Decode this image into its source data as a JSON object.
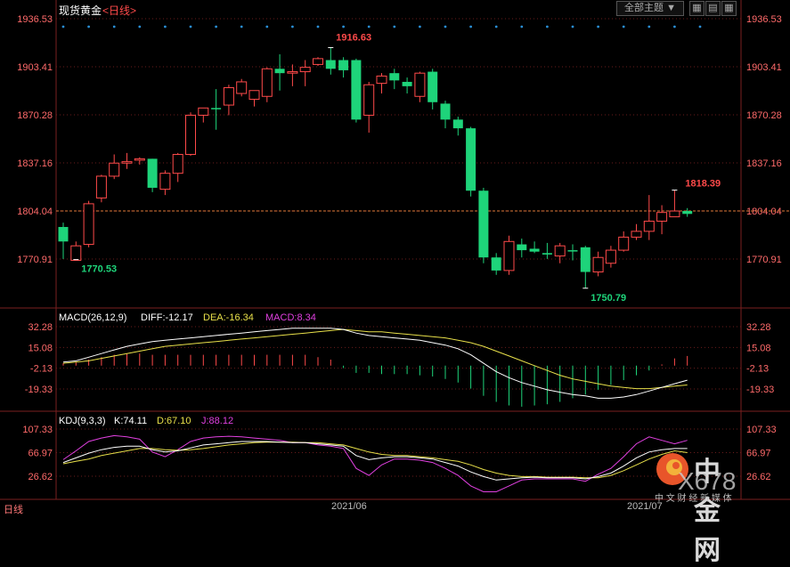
{
  "header": {
    "instrument": "现货黄金",
    "period": "<日线>",
    "theme_button": "全部主题",
    "theme_arrow": "▼"
  },
  "toolbar_icons": [
    "grid-icon",
    "chart-icon",
    "grid-icon"
  ],
  "footer": {
    "period_tab": "日线",
    "date_labels": [
      "2021/06",
      "2021/07"
    ]
  },
  "watermark": {
    "brand": "中金网",
    "tagline": "中 文 财 经 新 媒 体",
    "logo_text": "X678"
  },
  "colors": {
    "up": "#ff4a4a",
    "down": "#1ed47a",
    "dif": "#ffffff",
    "dea": "#e8e04a",
    "macd": "#e040e0",
    "k": "#ffffff",
    "d": "#e8e04a",
    "j": "#e040e0",
    "ref_line": "#e07a3a",
    "grid": "#6a1c1c",
    "dots": "#2a8fd6"
  },
  "chart_data": [
    {
      "type": "candlestick",
      "y_ticks": [
        "1936.53",
        "1903.41",
        "1870.28",
        "1837.16",
        "1804.04",
        "1770.91"
      ],
      "reference_price": 1804.04,
      "annotations": {
        "high": "1916.63",
        "low1": "1770.53",
        "low2": "1750.79",
        "last_high": "1818.39"
      },
      "ohlc": [
        [
          1783,
          1793,
          1771,
          1796,
          "down"
        ],
        [
          1770,
          1780,
          1770.5,
          1783,
          "up"
        ],
        [
          1781,
          1809,
          1779,
          1811,
          "up"
        ],
        [
          1813,
          1828,
          1810,
          1829,
          "up"
        ],
        [
          1828,
          1837,
          1826,
          1843,
          "up"
        ],
        [
          1837,
          1838,
          1833,
          1844,
          "up"
        ],
        [
          1839,
          1840,
          1836,
          1841,
          "up"
        ],
        [
          1820,
          1840,
          1817,
          1840,
          "down"
        ],
        [
          1819,
          1830,
          1815,
          1832,
          "up"
        ],
        [
          1830,
          1843,
          1824,
          1844,
          "up"
        ],
        [
          1843,
          1870,
          1842,
          1872,
          "up"
        ],
        [
          1870,
          1875,
          1865,
          1875,
          "up"
        ],
        [
          1875,
          1875,
          1860,
          1888,
          "down"
        ],
        [
          1877,
          1889,
          1870,
          1891,
          "up"
        ],
        [
          1885,
          1893,
          1883,
          1895,
          "up"
        ],
        [
          1881,
          1887,
          1876,
          1887,
          "up"
        ],
        [
          1883,
          1902,
          1879,
          1903,
          "up"
        ],
        [
          1902,
          1899,
          1887,
          1912,
          "down"
        ],
        [
          1899,
          1900,
          1890,
          1905,
          "up"
        ],
        [
          1900,
          1903,
          1890,
          1908,
          "up"
        ],
        [
          1905,
          1909,
          1904,
          1910,
          "up"
        ],
        [
          1908,
          1902,
          1898,
          1916.63,
          "down"
        ],
        [
          1908,
          1901,
          1896,
          1910,
          "down"
        ],
        [
          1908,
          1867,
          1865,
          1909,
          "down"
        ],
        [
          1870,
          1891,
          1858,
          1893,
          "up"
        ],
        [
          1892,
          1897,
          1885,
          1899,
          "up"
        ],
        [
          1899,
          1894,
          1888,
          1902,
          "down"
        ],
        [
          1893,
          1890,
          1885,
          1896,
          "down"
        ],
        [
          1883,
          1899,
          1879,
          1900,
          "up"
        ],
        [
          1900,
          1879,
          1874,
          1902,
          "down"
        ],
        [
          1878,
          1867,
          1861,
          1880,
          "down"
        ],
        [
          1867,
          1861,
          1856,
          1869,
          "down"
        ],
        [
          1861,
          1818,
          1814,
          1862,
          "down"
        ],
        [
          1818,
          1772,
          1768,
          1820,
          "down"
        ],
        [
          1772,
          1763,
          1760,
          1775,
          "down"
        ],
        [
          1763,
          1783,
          1760,
          1787,
          "up"
        ],
        [
          1781,
          1777,
          1772,
          1785,
          "down"
        ],
        [
          1778,
          1776,
          1775,
          1783,
          "down"
        ],
        [
          1775,
          1774,
          1771,
          1782,
          "down"
        ],
        [
          1773,
          1780,
          1768,
          1782,
          "up"
        ],
        [
          1777,
          1777,
          1770,
          1781,
          "down"
        ],
        [
          1779,
          1762,
          1750.79,
          1780,
          "down"
        ],
        [
          1762,
          1772,
          1759,
          1776,
          "up"
        ],
        [
          1768,
          1777,
          1765,
          1780,
          "up"
        ],
        [
          1777,
          1786,
          1776,
          1790,
          "up"
        ],
        [
          1786,
          1790,
          1784,
          1795,
          "up"
        ],
        [
          1790,
          1797,
          1784,
          1815,
          "up"
        ],
        [
          1797,
          1803,
          1788,
          1808,
          "up"
        ],
        [
          1800,
          1804,
          1802,
          1818.39,
          "up"
        ],
        [
          1804,
          1802,
          1800,
          1806,
          "down"
        ]
      ]
    },
    {
      "type": "line",
      "title": "MACD(26,12,9)",
      "readouts": {
        "dif": "DIFF:-12.17",
        "dea": "DEA:-16.34",
        "macd": "MACD:8.34"
      },
      "y_ticks": [
        "32.28",
        "15.08",
        "-2.13",
        "-19.33"
      ],
      "ylim": [
        -35,
        40
      ],
      "dif": [
        3,
        4,
        7,
        10,
        13,
        16,
        18,
        20,
        21,
        22,
        23,
        24,
        25,
        26,
        27,
        28,
        29,
        30,
        31,
        31,
        31,
        31,
        30,
        27,
        25,
        24,
        23,
        22,
        21,
        19,
        17,
        14,
        9,
        2,
        -5,
        -10,
        -14,
        -17,
        -20,
        -22,
        -24,
        -25,
        -27,
        -27,
        -26,
        -24,
        -21,
        -18,
        -15,
        -12
      ],
      "dea": [
        2,
        3,
        4,
        6,
        8,
        10,
        12,
        14,
        16,
        17,
        18,
        19,
        20,
        21,
        22,
        23,
        24,
        25,
        26,
        27,
        28,
        29,
        30,
        29,
        28,
        28,
        27,
        26,
        25,
        24,
        23,
        21,
        19,
        16,
        12,
        8,
        4,
        0,
        -4,
        -8,
        -11,
        -13,
        -15,
        -17,
        -18,
        -19,
        -19,
        -18,
        -17,
        -16
      ],
      "macd": [
        2,
        3,
        5,
        7,
        9,
        10,
        10,
        9,
        9,
        9,
        9,
        9,
        9,
        9,
        9,
        9,
        9,
        9,
        9,
        9,
        7,
        5,
        -2,
        -6,
        -6,
        -7,
        -7,
        -7,
        -8,
        -9,
        -11,
        -14,
        -19,
        -25,
        -30,
        -33,
        -34,
        -33,
        -32,
        -30,
        -27,
        -24,
        -20,
        -16,
        -12,
        -8,
        -4,
        1,
        6,
        8
      ]
    },
    {
      "type": "line",
      "title": "KDJ(9,3,3)",
      "readouts": {
        "k": "K:74.11",
        "d": "D:67.10",
        "j": "J:88.12"
      },
      "y_ticks": [
        "107.33",
        "66.97",
        "26.62"
      ],
      "ylim": [
        5,
        125
      ],
      "k": [
        50,
        58,
        66,
        72,
        76,
        78,
        78,
        72,
        68,
        70,
        75,
        80,
        82,
        84,
        86,
        86,
        86,
        85,
        84,
        84,
        82,
        80,
        78,
        62,
        55,
        58,
        60,
        60,
        58,
        56,
        50,
        44,
        34,
        26,
        20,
        22,
        24,
        25,
        24,
        24,
        24,
        22,
        26,
        32,
        44,
        58,
        68,
        72,
        74,
        74
      ],
      "d": [
        48,
        52,
        56,
        62,
        66,
        70,
        74,
        74,
        72,
        71,
        72,
        74,
        77,
        80,
        82,
        84,
        85,
        85,
        85,
        84,
        84,
        82,
        80,
        74,
        68,
        64,
        62,
        62,
        60,
        58,
        55,
        52,
        46,
        38,
        32,
        28,
        26,
        26,
        25,
        25,
        25,
        24,
        24,
        28,
        36,
        46,
        56,
        64,
        70,
        67
      ],
      "j": [
        55,
        70,
        86,
        92,
        96,
        94,
        90,
        68,
        60,
        72,
        86,
        92,
        94,
        95,
        94,
        92,
        90,
        88,
        84,
        84,
        80,
        78,
        74,
        40,
        28,
        46,
        56,
        56,
        54,
        50,
        40,
        28,
        10,
        0,
        0,
        10,
        20,
        22,
        22,
        22,
        22,
        18,
        30,
        40,
        60,
        82,
        94,
        88,
        82,
        88
      ]
    }
  ]
}
